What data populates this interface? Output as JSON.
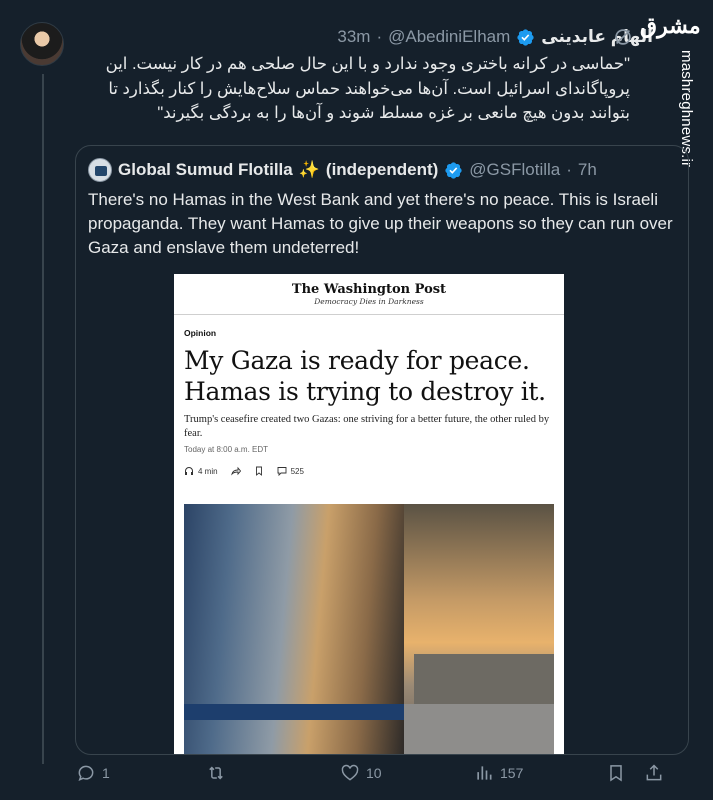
{
  "watermark": {
    "logo_text": "مشرق",
    "site": "mashreghnews.ir"
  },
  "tweet": {
    "author_name": "الهام عابدینی",
    "handle": "@AbediniElham",
    "separator": "·",
    "time": "33m",
    "text": "\"حماسی در کرانه باختری وجود ندارد و با این حال صلحی هم در کار نیست. این پروپاگاندای اسرائیل است. آن‌ها می‌خواهند حماس سلاح‌هایش را کنار بگذارد تا بتوانند بدون هیچ مانعی بر غزه مسلط شوند و آن‌ها را به بردگی بگیرند\"",
    "icons": {
      "verified": "verified-badge-icon",
      "grok": "grok-icon"
    },
    "actions": {
      "replies": "1",
      "retweets": "",
      "likes": "10",
      "views": "157"
    }
  },
  "quote": {
    "author_name": "Global Sumud Flotilla",
    "sparkle": "✨",
    "author_suffix": "(independent)",
    "handle": "@GSFlotilla",
    "separator": "·",
    "time": "7h",
    "text": "There's no Hamas in the West Bank and yet there's no peace. This is Israeli propaganda. They want Hamas to give up their weapons so they can run over Gaza and enslave them undeterred!"
  },
  "article": {
    "masthead": "The Washington Post",
    "tagline": "Democracy Dies in Darkness",
    "section": "Opinion",
    "headline": "My Gaza is ready for peace. Hamas is trying to destroy it.",
    "subheadline": "Trump's ceasefire created two Gazas: one striving for a better future, the other ruled by fear.",
    "dateline": "Today at 8:00 a.m. EDT",
    "listen_time": "4 min",
    "comments": "525"
  },
  "colors": {
    "background": "#15202b",
    "text": "#e7e9ea",
    "muted": "#8b98a5",
    "verified": "#1d9bf0"
  }
}
